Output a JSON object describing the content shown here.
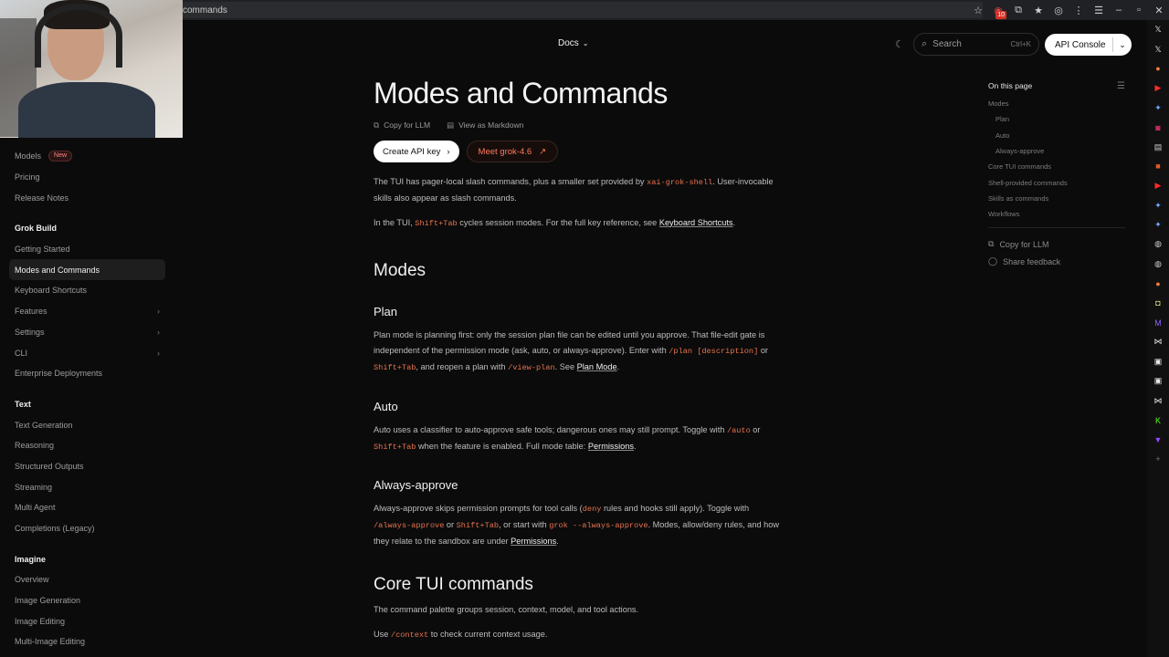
{
  "browser": {
    "url_text": "commands",
    "badge_count": "10"
  },
  "nav": {
    "docs_label": "Docs",
    "search_placeholder": "Search",
    "search_shortcut": "Ctrl+K",
    "api_console_label": "API Console"
  },
  "sidebar": {
    "top_items": [
      {
        "label": "Models",
        "badge": "New"
      },
      {
        "label": "Pricing"
      },
      {
        "label": "Release Notes"
      }
    ],
    "sections": [
      {
        "heading": "Grok Build",
        "items": [
          {
            "label": "Getting Started"
          },
          {
            "label": "Modes and Commands",
            "active": true
          },
          {
            "label": "Keyboard Shortcuts"
          },
          {
            "label": "Features",
            "expandable": true
          },
          {
            "label": "Settings",
            "expandable": true
          },
          {
            "label": "CLI",
            "expandable": true
          },
          {
            "label": "Enterprise Deployments"
          }
        ]
      },
      {
        "heading": "Text",
        "items": [
          {
            "label": "Text Generation"
          },
          {
            "label": "Reasoning"
          },
          {
            "label": "Structured Outputs"
          },
          {
            "label": "Streaming"
          },
          {
            "label": "Multi Agent"
          },
          {
            "label": "Completions (Legacy)"
          }
        ]
      },
      {
        "heading": "Imagine",
        "items": [
          {
            "label": "Overview"
          },
          {
            "label": "Image Generation"
          },
          {
            "label": "Image Editing"
          },
          {
            "label": "Multi-Image Editing"
          }
        ]
      }
    ]
  },
  "article": {
    "title": "Modes and Commands",
    "copy_for_llm": "Copy for LLM",
    "view_as_markdown": "View as Markdown",
    "create_api_key": "Create API key",
    "meet_grok": "Meet grok-4.6",
    "intro": {
      "t1": "The TUI has pager-local slash commands, plus a smaller set provided by ",
      "c1": "xai-grok-shell",
      "t2": ". User-invocable skills also appear as slash commands."
    },
    "intro2": {
      "t1": "In the TUI, ",
      "c1": "Shift+Tab",
      "t2": " cycles session modes. For the full key reference, see ",
      "link": "Keyboard Shortcuts",
      "t3": "."
    },
    "modes_heading": "Modes",
    "plan": {
      "heading": "Plan",
      "t1": "Plan mode is planning first: only the session plan file can be edited until you approve. That file-edit gate is independent of the permission mode (ask, auto, or always-approve). Enter with ",
      "c1": "/plan [description]",
      "t2": " or ",
      "c2": "Shift+Tab",
      "t3": ", and reopen a plan with ",
      "c3": "/view-plan",
      "t4": ". See ",
      "link": "Plan Mode",
      "t5": "."
    },
    "auto": {
      "heading": "Auto",
      "t1": "Auto uses a classifier to auto-approve safe tools; dangerous ones may still prompt. Toggle with ",
      "c1": "/auto",
      "t2": " or ",
      "c2": "Shift+Tab",
      "t3": " when the feature is enabled. Full mode table: ",
      "link": "Permissions",
      "t4": "."
    },
    "always": {
      "heading": "Always-approve",
      "t1": "Always-approve skips permission prompts for tool calls (",
      "c1": "deny",
      "t2": " rules and hooks still apply). Toggle with ",
      "c2": "/always-approve",
      "t3": " or ",
      "c3": "Shift+Tab",
      "t4": ", or start with ",
      "c4": "grok --always-approve",
      "t5": ". Modes, allow/deny rules, and how they relate to the sandbox are under ",
      "link": "Permissions",
      "t6": "."
    },
    "core_heading": "Core TUI commands",
    "core_p1": "The command palette groups session, context, model, and tool actions.",
    "core_p2": {
      "t1": "Use ",
      "c1": "/context",
      "t2": " to check current context usage."
    }
  },
  "toc": {
    "title": "On this page",
    "items": [
      {
        "label": "Modes",
        "sub": false
      },
      {
        "label": "Plan",
        "sub": true
      },
      {
        "label": "Auto",
        "sub": true
      },
      {
        "label": "Always-approve",
        "sub": true
      },
      {
        "label": "Core TUI commands",
        "sub": false
      },
      {
        "label": "Shell-provided commands",
        "sub": false
      },
      {
        "label": "Skills as commands",
        "sub": false
      },
      {
        "label": "Workflows",
        "sub": false
      }
    ],
    "copy_for_llm": "Copy for LLM",
    "share_feedback": "Share feedback"
  },
  "extensions": [
    {
      "icon": "x-icon",
      "glyph": "𝕏",
      "color": "#e6e6e6"
    },
    {
      "icon": "x-icon",
      "glyph": "𝕏",
      "color": "#e6e6e6"
    },
    {
      "icon": "brave-icon",
      "glyph": "●",
      "color": "#f07a3a"
    },
    {
      "icon": "youtube-icon",
      "glyph": "▶",
      "color": "#ff2b2b"
    },
    {
      "icon": "gemini-icon",
      "glyph": "✦",
      "color": "#6ea8ff"
    },
    {
      "icon": "instagram-icon",
      "glyph": "◙",
      "color": "#e1306c"
    },
    {
      "icon": "clipboard-icon",
      "glyph": "▤",
      "color": "#cfcfcf"
    },
    {
      "icon": "bookmark-icon",
      "glyph": "■",
      "color": "#e05a28"
    },
    {
      "icon": "youtube-icon",
      "glyph": "▶",
      "color": "#ff2b2b"
    },
    {
      "icon": "gemini-icon",
      "glyph": "✦",
      "color": "#6ea8ff"
    },
    {
      "icon": "gemini-icon",
      "glyph": "✦",
      "color": "#6ea8ff"
    },
    {
      "icon": "globe-icon",
      "glyph": "◍",
      "color": "#cfcfcf"
    },
    {
      "icon": "globe-icon",
      "glyph": "◍",
      "color": "#cfcfcf"
    },
    {
      "icon": "brave-icon",
      "glyph": "●",
      "color": "#f07a3a"
    },
    {
      "icon": "app-icon",
      "glyph": "◘",
      "color": "#d9d27a"
    },
    {
      "icon": "mail-icon",
      "glyph": "M",
      "color": "#8a63ff"
    },
    {
      "icon": "grok-icon",
      "glyph": "⋈",
      "color": "#e6e6e6"
    },
    {
      "icon": "image-icon",
      "glyph": "▣",
      "color": "#e6e6e6"
    },
    {
      "icon": "image-icon",
      "glyph": "▣",
      "color": "#e6e6e6"
    },
    {
      "icon": "grok-icon",
      "glyph": "⋈",
      "color": "#e6e6e6"
    },
    {
      "icon": "kick-icon",
      "glyph": "K",
      "color": "#53fc18"
    },
    {
      "icon": "twitch-icon",
      "glyph": "▼",
      "color": "#9146ff"
    },
    {
      "icon": "add-icon",
      "glyph": "+",
      "color": "#777"
    }
  ]
}
